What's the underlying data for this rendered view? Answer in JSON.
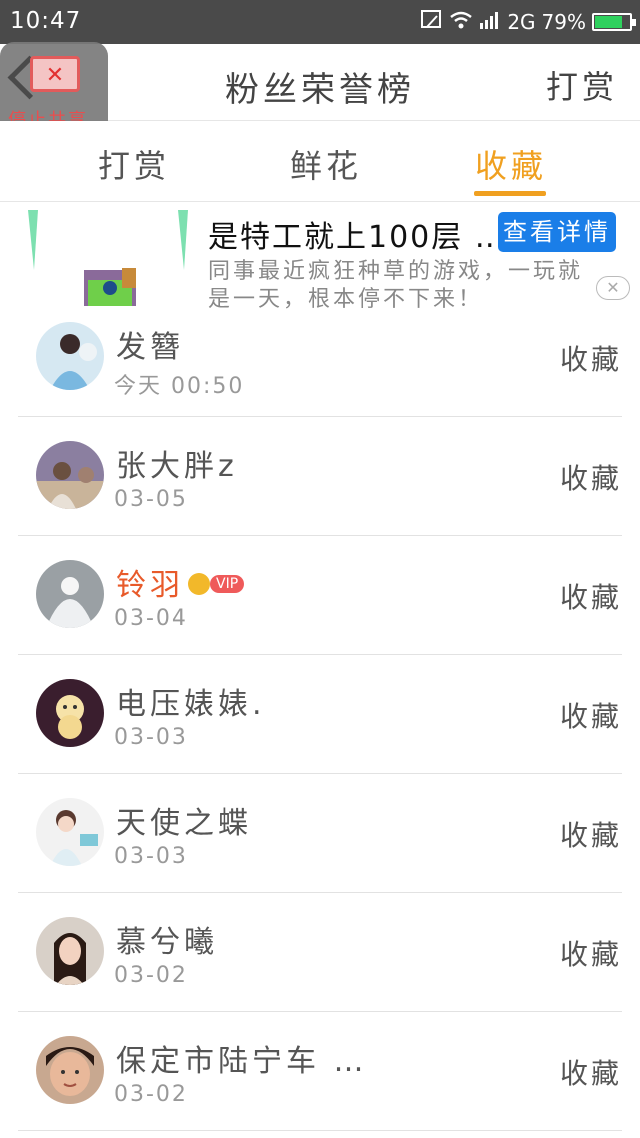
{
  "status_bar": {
    "time": "10:47",
    "network": "2G",
    "battery": "79%",
    "battery_level": 0.79,
    "icons": [
      "screenshot-icon",
      "wifi-icon",
      "signal-icon",
      "battery-icon"
    ]
  },
  "floating_overlay": {
    "label": "停止共享"
  },
  "nav": {
    "title": "粉丝荣誉榜",
    "right_action": "打赏"
  },
  "tabs": [
    {
      "label": "打赏"
    },
    {
      "label": "鲜花"
    },
    {
      "label": "收藏",
      "active": true
    }
  ],
  "ad": {
    "title": "是特工就上100层 …",
    "button": "查看详情",
    "desc": "同事最近疯狂种草的游戏，一玩就是一天，根本停不下来！"
  },
  "fans": [
    {
      "name": "发簪",
      "date": "今天 00:50",
      "action": "收藏"
    },
    {
      "name": "张大胖z",
      "date": "03-05",
      "action": "收藏"
    },
    {
      "name": "铃羽",
      "vip": "VIP",
      "date": "03-04",
      "action": "收藏"
    },
    {
      "name": "电压婊婊.",
      "date": "03-03",
      "action": "收藏"
    },
    {
      "name": "天使之蝶",
      "date": "03-03",
      "action": "收藏"
    },
    {
      "name": "慕兮曦",
      "date": "03-02",
      "action": "收藏"
    },
    {
      "name": "保定市陆宁车 …",
      "date": "03-02",
      "action": "收藏"
    }
  ],
  "colors": {
    "accent": "#f0a020",
    "vip_name": "#e85a2a",
    "status_bar": "#4a4a4a",
    "ad_button": "#1a7ee8"
  }
}
